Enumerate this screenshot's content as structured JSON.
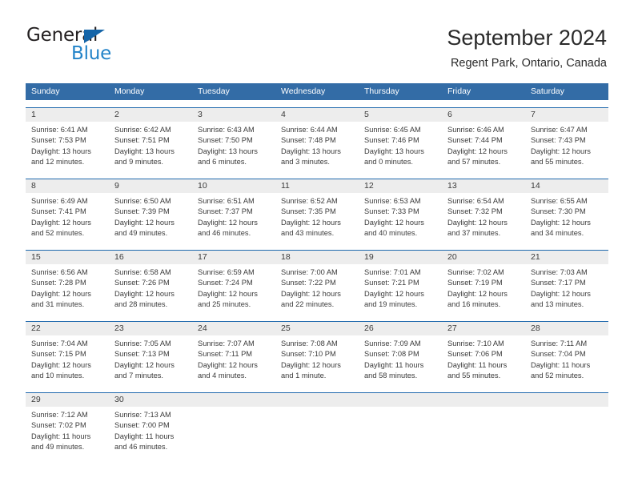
{
  "brand": {
    "name_part1": "General",
    "name_part2": "Blue",
    "triangle_color": "#1565a8",
    "blue_text_color": "#2283c8"
  },
  "header": {
    "title": "September 2024",
    "subtitle": "Regent Park, Ontario, Canada"
  },
  "theme": {
    "header_row_bg": "#336ca6",
    "week_divider": "#1f69ad",
    "daynum_band_bg": "#ededed",
    "text": "#3b3b3b"
  },
  "weekdays": [
    "Sunday",
    "Monday",
    "Tuesday",
    "Wednesday",
    "Thursday",
    "Friday",
    "Saturday"
  ],
  "weeks": [
    {
      "days": [
        {
          "num": "1",
          "sunrise": "Sunrise: 6:41 AM",
          "sunset": "Sunset: 7:53 PM",
          "daylight1": "Daylight: 13 hours",
          "daylight2": "and 12 minutes."
        },
        {
          "num": "2",
          "sunrise": "Sunrise: 6:42 AM",
          "sunset": "Sunset: 7:51 PM",
          "daylight1": "Daylight: 13 hours",
          "daylight2": "and 9 minutes."
        },
        {
          "num": "3",
          "sunrise": "Sunrise: 6:43 AM",
          "sunset": "Sunset: 7:50 PM",
          "daylight1": "Daylight: 13 hours",
          "daylight2": "and 6 minutes."
        },
        {
          "num": "4",
          "sunrise": "Sunrise: 6:44 AM",
          "sunset": "Sunset: 7:48 PM",
          "daylight1": "Daylight: 13 hours",
          "daylight2": "and 3 minutes."
        },
        {
          "num": "5",
          "sunrise": "Sunrise: 6:45 AM",
          "sunset": "Sunset: 7:46 PM",
          "daylight1": "Daylight: 13 hours",
          "daylight2": "and 0 minutes."
        },
        {
          "num": "6",
          "sunrise": "Sunrise: 6:46 AM",
          "sunset": "Sunset: 7:44 PM",
          "daylight1": "Daylight: 12 hours",
          "daylight2": "and 57 minutes."
        },
        {
          "num": "7",
          "sunrise": "Sunrise: 6:47 AM",
          "sunset": "Sunset: 7:43 PM",
          "daylight1": "Daylight: 12 hours",
          "daylight2": "and 55 minutes."
        }
      ]
    },
    {
      "days": [
        {
          "num": "8",
          "sunrise": "Sunrise: 6:49 AM",
          "sunset": "Sunset: 7:41 PM",
          "daylight1": "Daylight: 12 hours",
          "daylight2": "and 52 minutes."
        },
        {
          "num": "9",
          "sunrise": "Sunrise: 6:50 AM",
          "sunset": "Sunset: 7:39 PM",
          "daylight1": "Daylight: 12 hours",
          "daylight2": "and 49 minutes."
        },
        {
          "num": "10",
          "sunrise": "Sunrise: 6:51 AM",
          "sunset": "Sunset: 7:37 PM",
          "daylight1": "Daylight: 12 hours",
          "daylight2": "and 46 minutes."
        },
        {
          "num": "11",
          "sunrise": "Sunrise: 6:52 AM",
          "sunset": "Sunset: 7:35 PM",
          "daylight1": "Daylight: 12 hours",
          "daylight2": "and 43 minutes."
        },
        {
          "num": "12",
          "sunrise": "Sunrise: 6:53 AM",
          "sunset": "Sunset: 7:33 PM",
          "daylight1": "Daylight: 12 hours",
          "daylight2": "and 40 minutes."
        },
        {
          "num": "13",
          "sunrise": "Sunrise: 6:54 AM",
          "sunset": "Sunset: 7:32 PM",
          "daylight1": "Daylight: 12 hours",
          "daylight2": "and 37 minutes."
        },
        {
          "num": "14",
          "sunrise": "Sunrise: 6:55 AM",
          "sunset": "Sunset: 7:30 PM",
          "daylight1": "Daylight: 12 hours",
          "daylight2": "and 34 minutes."
        }
      ]
    },
    {
      "days": [
        {
          "num": "15",
          "sunrise": "Sunrise: 6:56 AM",
          "sunset": "Sunset: 7:28 PM",
          "daylight1": "Daylight: 12 hours",
          "daylight2": "and 31 minutes."
        },
        {
          "num": "16",
          "sunrise": "Sunrise: 6:58 AM",
          "sunset": "Sunset: 7:26 PM",
          "daylight1": "Daylight: 12 hours",
          "daylight2": "and 28 minutes."
        },
        {
          "num": "17",
          "sunrise": "Sunrise: 6:59 AM",
          "sunset": "Sunset: 7:24 PM",
          "daylight1": "Daylight: 12 hours",
          "daylight2": "and 25 minutes."
        },
        {
          "num": "18",
          "sunrise": "Sunrise: 7:00 AM",
          "sunset": "Sunset: 7:22 PM",
          "daylight1": "Daylight: 12 hours",
          "daylight2": "and 22 minutes."
        },
        {
          "num": "19",
          "sunrise": "Sunrise: 7:01 AM",
          "sunset": "Sunset: 7:21 PM",
          "daylight1": "Daylight: 12 hours",
          "daylight2": "and 19 minutes."
        },
        {
          "num": "20",
          "sunrise": "Sunrise: 7:02 AM",
          "sunset": "Sunset: 7:19 PM",
          "daylight1": "Daylight: 12 hours",
          "daylight2": "and 16 minutes."
        },
        {
          "num": "21",
          "sunrise": "Sunrise: 7:03 AM",
          "sunset": "Sunset: 7:17 PM",
          "daylight1": "Daylight: 12 hours",
          "daylight2": "and 13 minutes."
        }
      ]
    },
    {
      "days": [
        {
          "num": "22",
          "sunrise": "Sunrise: 7:04 AM",
          "sunset": "Sunset: 7:15 PM",
          "daylight1": "Daylight: 12 hours",
          "daylight2": "and 10 minutes."
        },
        {
          "num": "23",
          "sunrise": "Sunrise: 7:05 AM",
          "sunset": "Sunset: 7:13 PM",
          "daylight1": "Daylight: 12 hours",
          "daylight2": "and 7 minutes."
        },
        {
          "num": "24",
          "sunrise": "Sunrise: 7:07 AM",
          "sunset": "Sunset: 7:11 PM",
          "daylight1": "Daylight: 12 hours",
          "daylight2": "and 4 minutes."
        },
        {
          "num": "25",
          "sunrise": "Sunrise: 7:08 AM",
          "sunset": "Sunset: 7:10 PM",
          "daylight1": "Daylight: 12 hours",
          "daylight2": "and 1 minute."
        },
        {
          "num": "26",
          "sunrise": "Sunrise: 7:09 AM",
          "sunset": "Sunset: 7:08 PM",
          "daylight1": "Daylight: 11 hours",
          "daylight2": "and 58 minutes."
        },
        {
          "num": "27",
          "sunrise": "Sunrise: 7:10 AM",
          "sunset": "Sunset: 7:06 PM",
          "daylight1": "Daylight: 11 hours",
          "daylight2": "and 55 minutes."
        },
        {
          "num": "28",
          "sunrise": "Sunrise: 7:11 AM",
          "sunset": "Sunset: 7:04 PM",
          "daylight1": "Daylight: 11 hours",
          "daylight2": "and 52 minutes."
        }
      ]
    },
    {
      "days": [
        {
          "num": "29",
          "sunrise": "Sunrise: 7:12 AM",
          "sunset": "Sunset: 7:02 PM",
          "daylight1": "Daylight: 11 hours",
          "daylight2": "and 49 minutes."
        },
        {
          "num": "30",
          "sunrise": "Sunrise: 7:13 AM",
          "sunset": "Sunset: 7:00 PM",
          "daylight1": "Daylight: 11 hours",
          "daylight2": "and 46 minutes."
        },
        {
          "num": "",
          "sunrise": "",
          "sunset": "",
          "daylight1": "",
          "daylight2": ""
        },
        {
          "num": "",
          "sunrise": "",
          "sunset": "",
          "daylight1": "",
          "daylight2": ""
        },
        {
          "num": "",
          "sunrise": "",
          "sunset": "",
          "daylight1": "",
          "daylight2": ""
        },
        {
          "num": "",
          "sunrise": "",
          "sunset": "",
          "daylight1": "",
          "daylight2": ""
        },
        {
          "num": "",
          "sunrise": "",
          "sunset": "",
          "daylight1": "",
          "daylight2": ""
        }
      ]
    }
  ]
}
